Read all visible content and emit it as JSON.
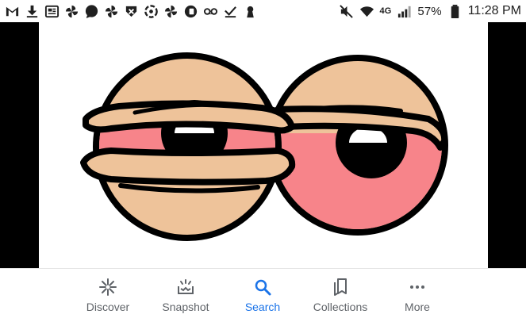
{
  "status_bar": {
    "battery_text": "57%",
    "time": "11:28 PM",
    "network_badge": "4G",
    "notification_icons": [
      "gmail-icon",
      "download-icon",
      "news-icon",
      "pinwheel-icon",
      "messages-icon",
      "pinwheel-icon",
      "mobile-vpn-icon",
      "unknown-app-icon",
      "pinwheel-icon",
      "unknown-app-icon",
      "voicemail-icon",
      "check-icon",
      "keyhole-icon"
    ],
    "system_icons": [
      "mute-icon",
      "wifi-icon",
      "signal-icon",
      "battery-icon"
    ]
  },
  "content": {
    "image_subject": "cartoon-tired-eyes",
    "colors": {
      "skin": "#eec39a",
      "eye_red": "#f7848a",
      "outline": "#000000",
      "letterbox": "#000000"
    }
  },
  "bottom_nav": {
    "items": [
      {
        "label": "Discover",
        "icon": "discover-icon",
        "active": false
      },
      {
        "label": "Snapshot",
        "icon": "snapshot-icon",
        "active": false
      },
      {
        "label": "Search",
        "icon": "search-icon",
        "active": true
      },
      {
        "label": "Collections",
        "icon": "collections-icon",
        "active": false
      },
      {
        "label": "More",
        "icon": "more-icon",
        "active": false
      }
    ],
    "active_color": "#1a73e8",
    "inactive_color": "#5f6368"
  }
}
